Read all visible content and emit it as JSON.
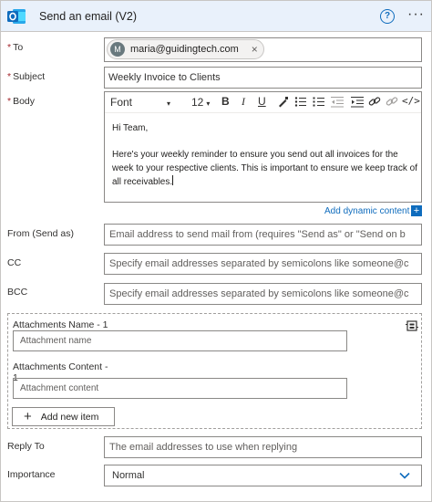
{
  "header": {
    "title": "Send an email (V2)",
    "help_icon": "help-circle-icon",
    "help_glyph": "?",
    "more_icon": "more-icon",
    "more_glyph": "···",
    "app_icon": "outlook-icon",
    "accent": "#0f6cbd"
  },
  "to": {
    "label": "To",
    "required_mark": "*",
    "recipient": {
      "initial": "M",
      "email": "maria@guidingtech.com",
      "remove_glyph": "×"
    }
  },
  "subject": {
    "label": "Subject",
    "required_mark": "*",
    "value": "Weekly Invoice to Clients"
  },
  "body": {
    "label": "Body",
    "required_mark": "*",
    "toolbar": {
      "font": "Font",
      "size": "12",
      "caret": "▾",
      "bold": "B",
      "italic": "I",
      "underline": "U",
      "code": "</>"
    },
    "paragraphs": [
      "Hi Team,",
      "Here's your weekly reminder to ensure you send out all invoices for the week to your respective clients. This is important to ensure we keep track of all receivables."
    ]
  },
  "dynamic_content": {
    "label": "Add dynamic content",
    "plus": "+"
  },
  "from": {
    "label": "From (Send as)",
    "placeholder": "Email address to send mail from (requires \"Send as\" or \"Send on b"
  },
  "cc": {
    "label": "CC",
    "placeholder": "Specify email addresses separated by semicolons like someone@c"
  },
  "bcc": {
    "label": "BCC",
    "placeholder": "Specify email addresses separated by semicolons like someone@c"
  },
  "attachments": {
    "name_label": "Attachments Name - 1",
    "name_placeholder": "Attachment name",
    "content_label": "Attachments Content - 1",
    "content_placeholder": "Attachment content",
    "add_button": "Add new item",
    "add_glyph": "+"
  },
  "reply_to": {
    "label": "Reply To",
    "placeholder": "The email addresses to use when replying"
  },
  "importance": {
    "label": "Importance",
    "value": "Normal"
  }
}
